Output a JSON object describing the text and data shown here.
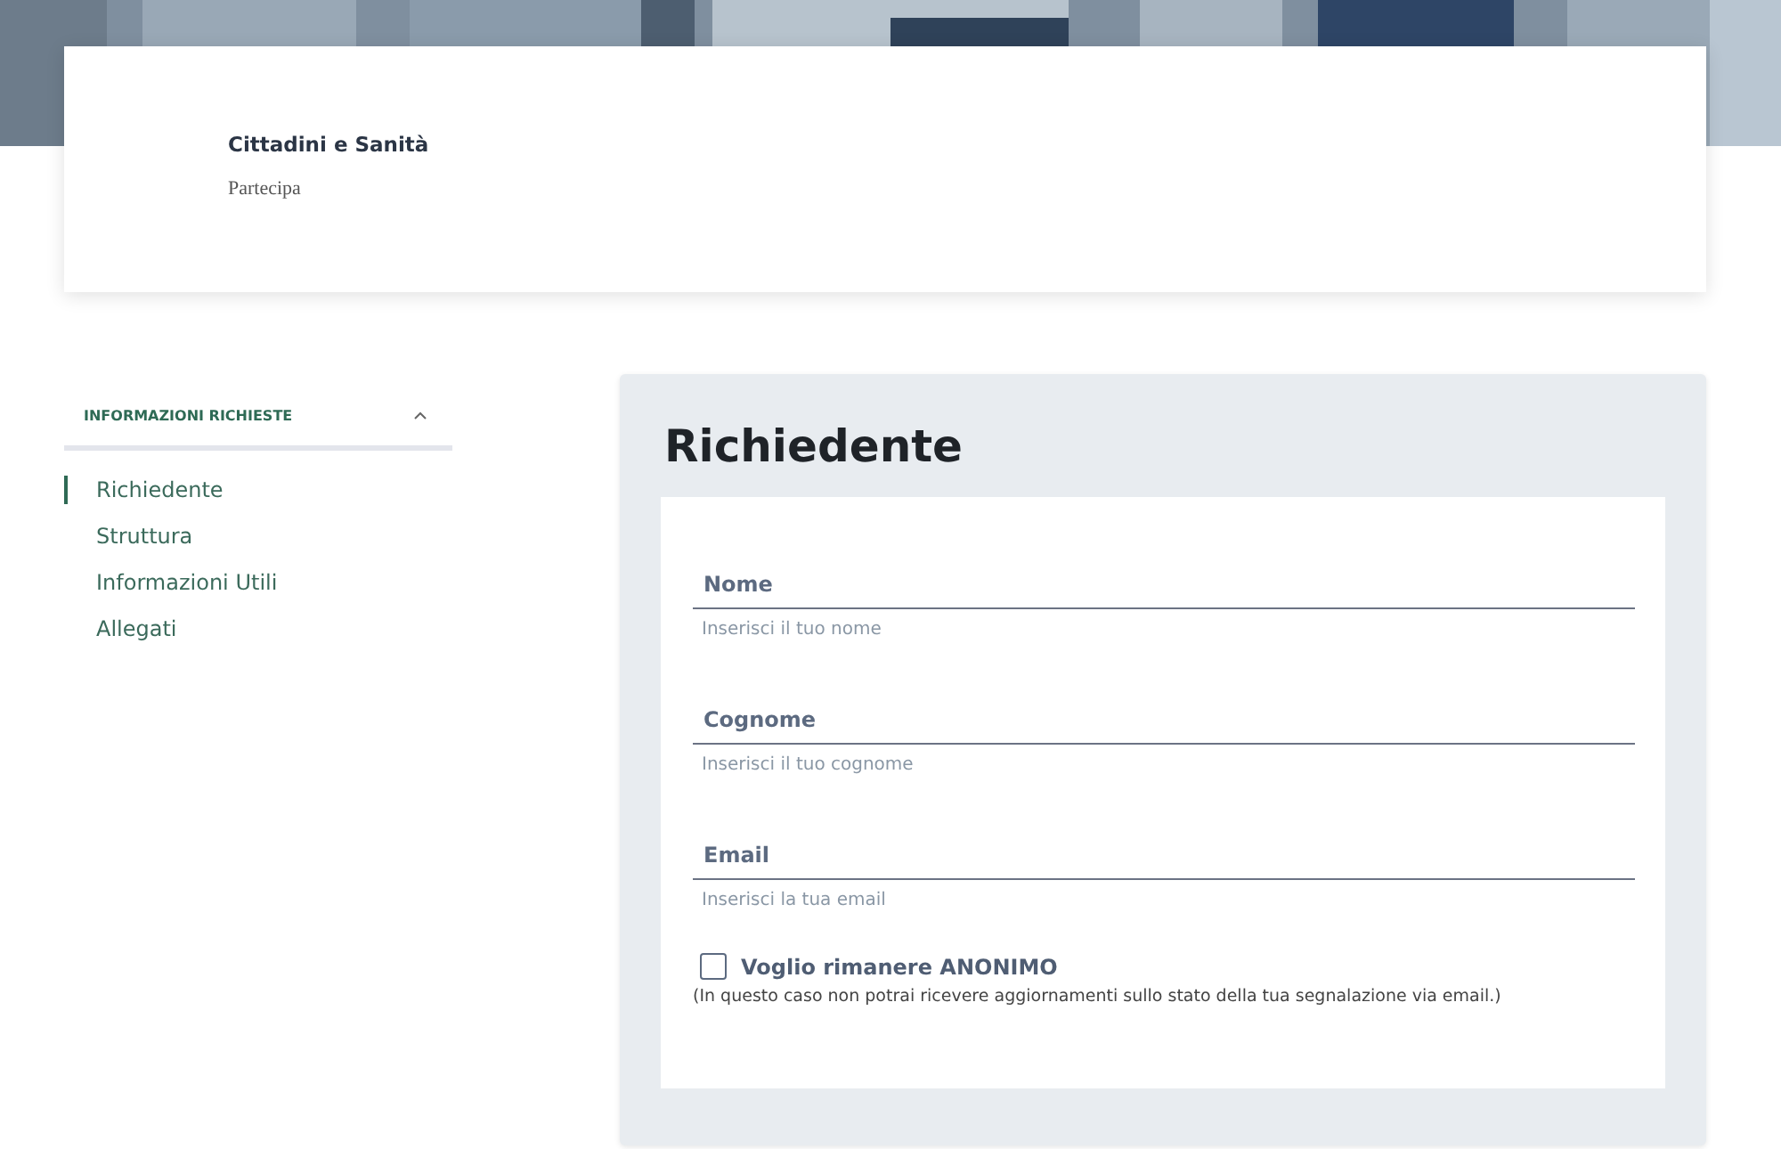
{
  "header": {
    "title": "Cittadini e Sanità",
    "subtitle": "Partecipa"
  },
  "sidebar": {
    "heading": "INFORMAZIONI RICHIESTE",
    "expanded": true,
    "items": [
      {
        "label": "Richiedente",
        "selected": true
      },
      {
        "label": "Struttura",
        "selected": false
      },
      {
        "label": "Informazioni Utili",
        "selected": false
      },
      {
        "label": "Allegati",
        "selected": false
      }
    ]
  },
  "section": {
    "title": "Richiedente",
    "fields": [
      {
        "label": "Nome",
        "hint": "Inserisci il tuo nome"
      },
      {
        "label": "Cognome",
        "hint": "Inserisci il tuo cognome"
      },
      {
        "label": "Email",
        "hint": "Inserisci la tua email"
      }
    ],
    "anonymous": {
      "label": "Voglio rimanere ANONIMO",
      "checked": false,
      "note": "(In questo caso non potrai ricevere aggiornamenti sullo stato della tua segnalazione via email.)"
    }
  }
}
